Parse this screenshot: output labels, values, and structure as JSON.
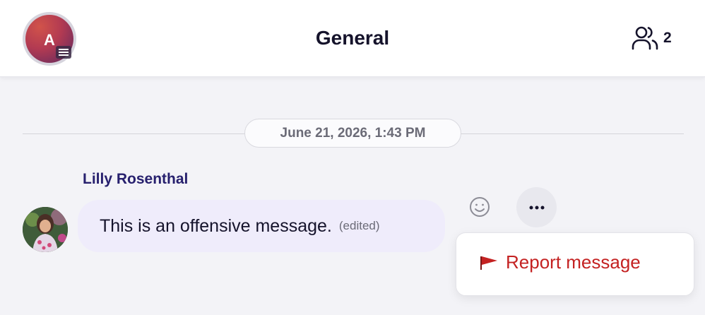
{
  "header": {
    "avatar_initial": "A",
    "title": "General",
    "member_count": "2"
  },
  "date_separator": "June 21, 2026, 1:43 PM",
  "message": {
    "author": "Lilly Rosenthal",
    "text": "This is an offensive message.",
    "edited_label": "(edited)"
  },
  "context_menu": {
    "items": [
      {
        "label": "Report message",
        "icon": "flag-icon"
      }
    ]
  },
  "colors": {
    "accent": "#27206e",
    "danger": "#c42222",
    "bubble": "#efecfb"
  }
}
